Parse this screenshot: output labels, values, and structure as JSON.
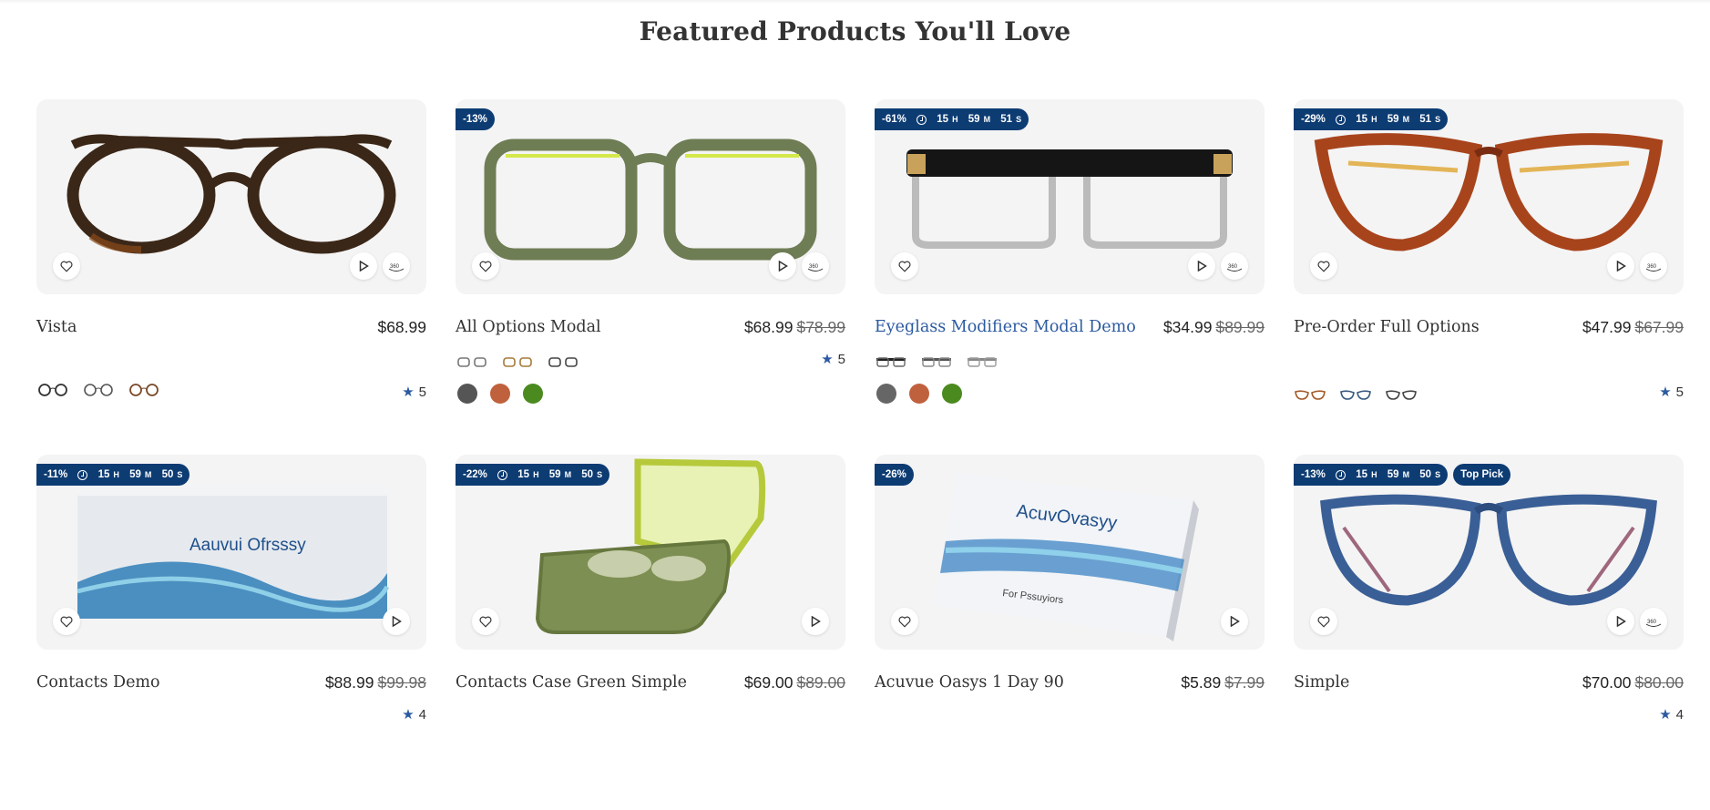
{
  "section": {
    "title": "Featured Products You'll Love"
  },
  "colors": {
    "badge": "#0d3c73",
    "star": "#2b5aa0",
    "link": "#2b5aa0"
  },
  "products": [
    {
      "name": "Vista",
      "price": "$68.99",
      "old_price": "",
      "rating": "5",
      "badges": []
    },
    {
      "name": "All Options Modal",
      "price": "$68.99",
      "old_price": "$78.99",
      "rating": "5",
      "badges": [
        {
          "discount": "-13%"
        }
      ],
      "swatches": [
        "#555555",
        "#c0613e",
        "#4a8a1f"
      ]
    },
    {
      "name": "Eyeglass Modifiers Modal Demo",
      "price": "$34.99",
      "old_price": "$89.99",
      "rating": "",
      "badges": [
        {
          "discount": "-61%",
          "h": "15",
          "m": "59",
          "s": "51"
        }
      ],
      "swatches": [
        "#666666",
        "#c0613e",
        "#4a8a1f"
      ]
    },
    {
      "name": "Pre-Order Full Options",
      "price": "$47.99",
      "old_price": "$67.99",
      "rating": "5",
      "badges": [
        {
          "discount": "-29%",
          "h": "15",
          "m": "59",
          "s": "51"
        }
      ]
    },
    {
      "name": "Contacts Demo",
      "price": "$88.99",
      "old_price": "$99.98",
      "rating": "4",
      "badges": [
        {
          "discount": "-11%",
          "h": "15",
          "m": "59",
          "s": "50"
        }
      ],
      "box_text": "Aauvui Ofrsssy"
    },
    {
      "name": "Contacts Case Green Simple",
      "price": "$69.00",
      "old_price": "$89.00",
      "rating": "",
      "badges": [
        {
          "discount": "-22%",
          "h": "15",
          "m": "59",
          "s": "50"
        }
      ]
    },
    {
      "name": "Acuvue Oasys 1 Day 90",
      "price": "$5.89",
      "old_price": "$7.99",
      "rating": "",
      "badges": [
        {
          "discount": "-26%"
        }
      ],
      "box_text": "AcuvOvasyy",
      "box_sub": "For Pssuyiors"
    },
    {
      "name": "Simple",
      "price": "$70.00",
      "old_price": "$80.00",
      "rating": "4",
      "badges": [
        {
          "discount": "-13%",
          "h": "15",
          "m": "59",
          "s": "50"
        },
        {
          "label": "Top Pick"
        }
      ]
    }
  ],
  "units": {
    "h": "H",
    "m": "M",
    "s": "S"
  },
  "icons": {
    "wishlist": "heart-icon",
    "video": "play-icon",
    "view360": "360-view-icon",
    "rating": "star-icon"
  }
}
